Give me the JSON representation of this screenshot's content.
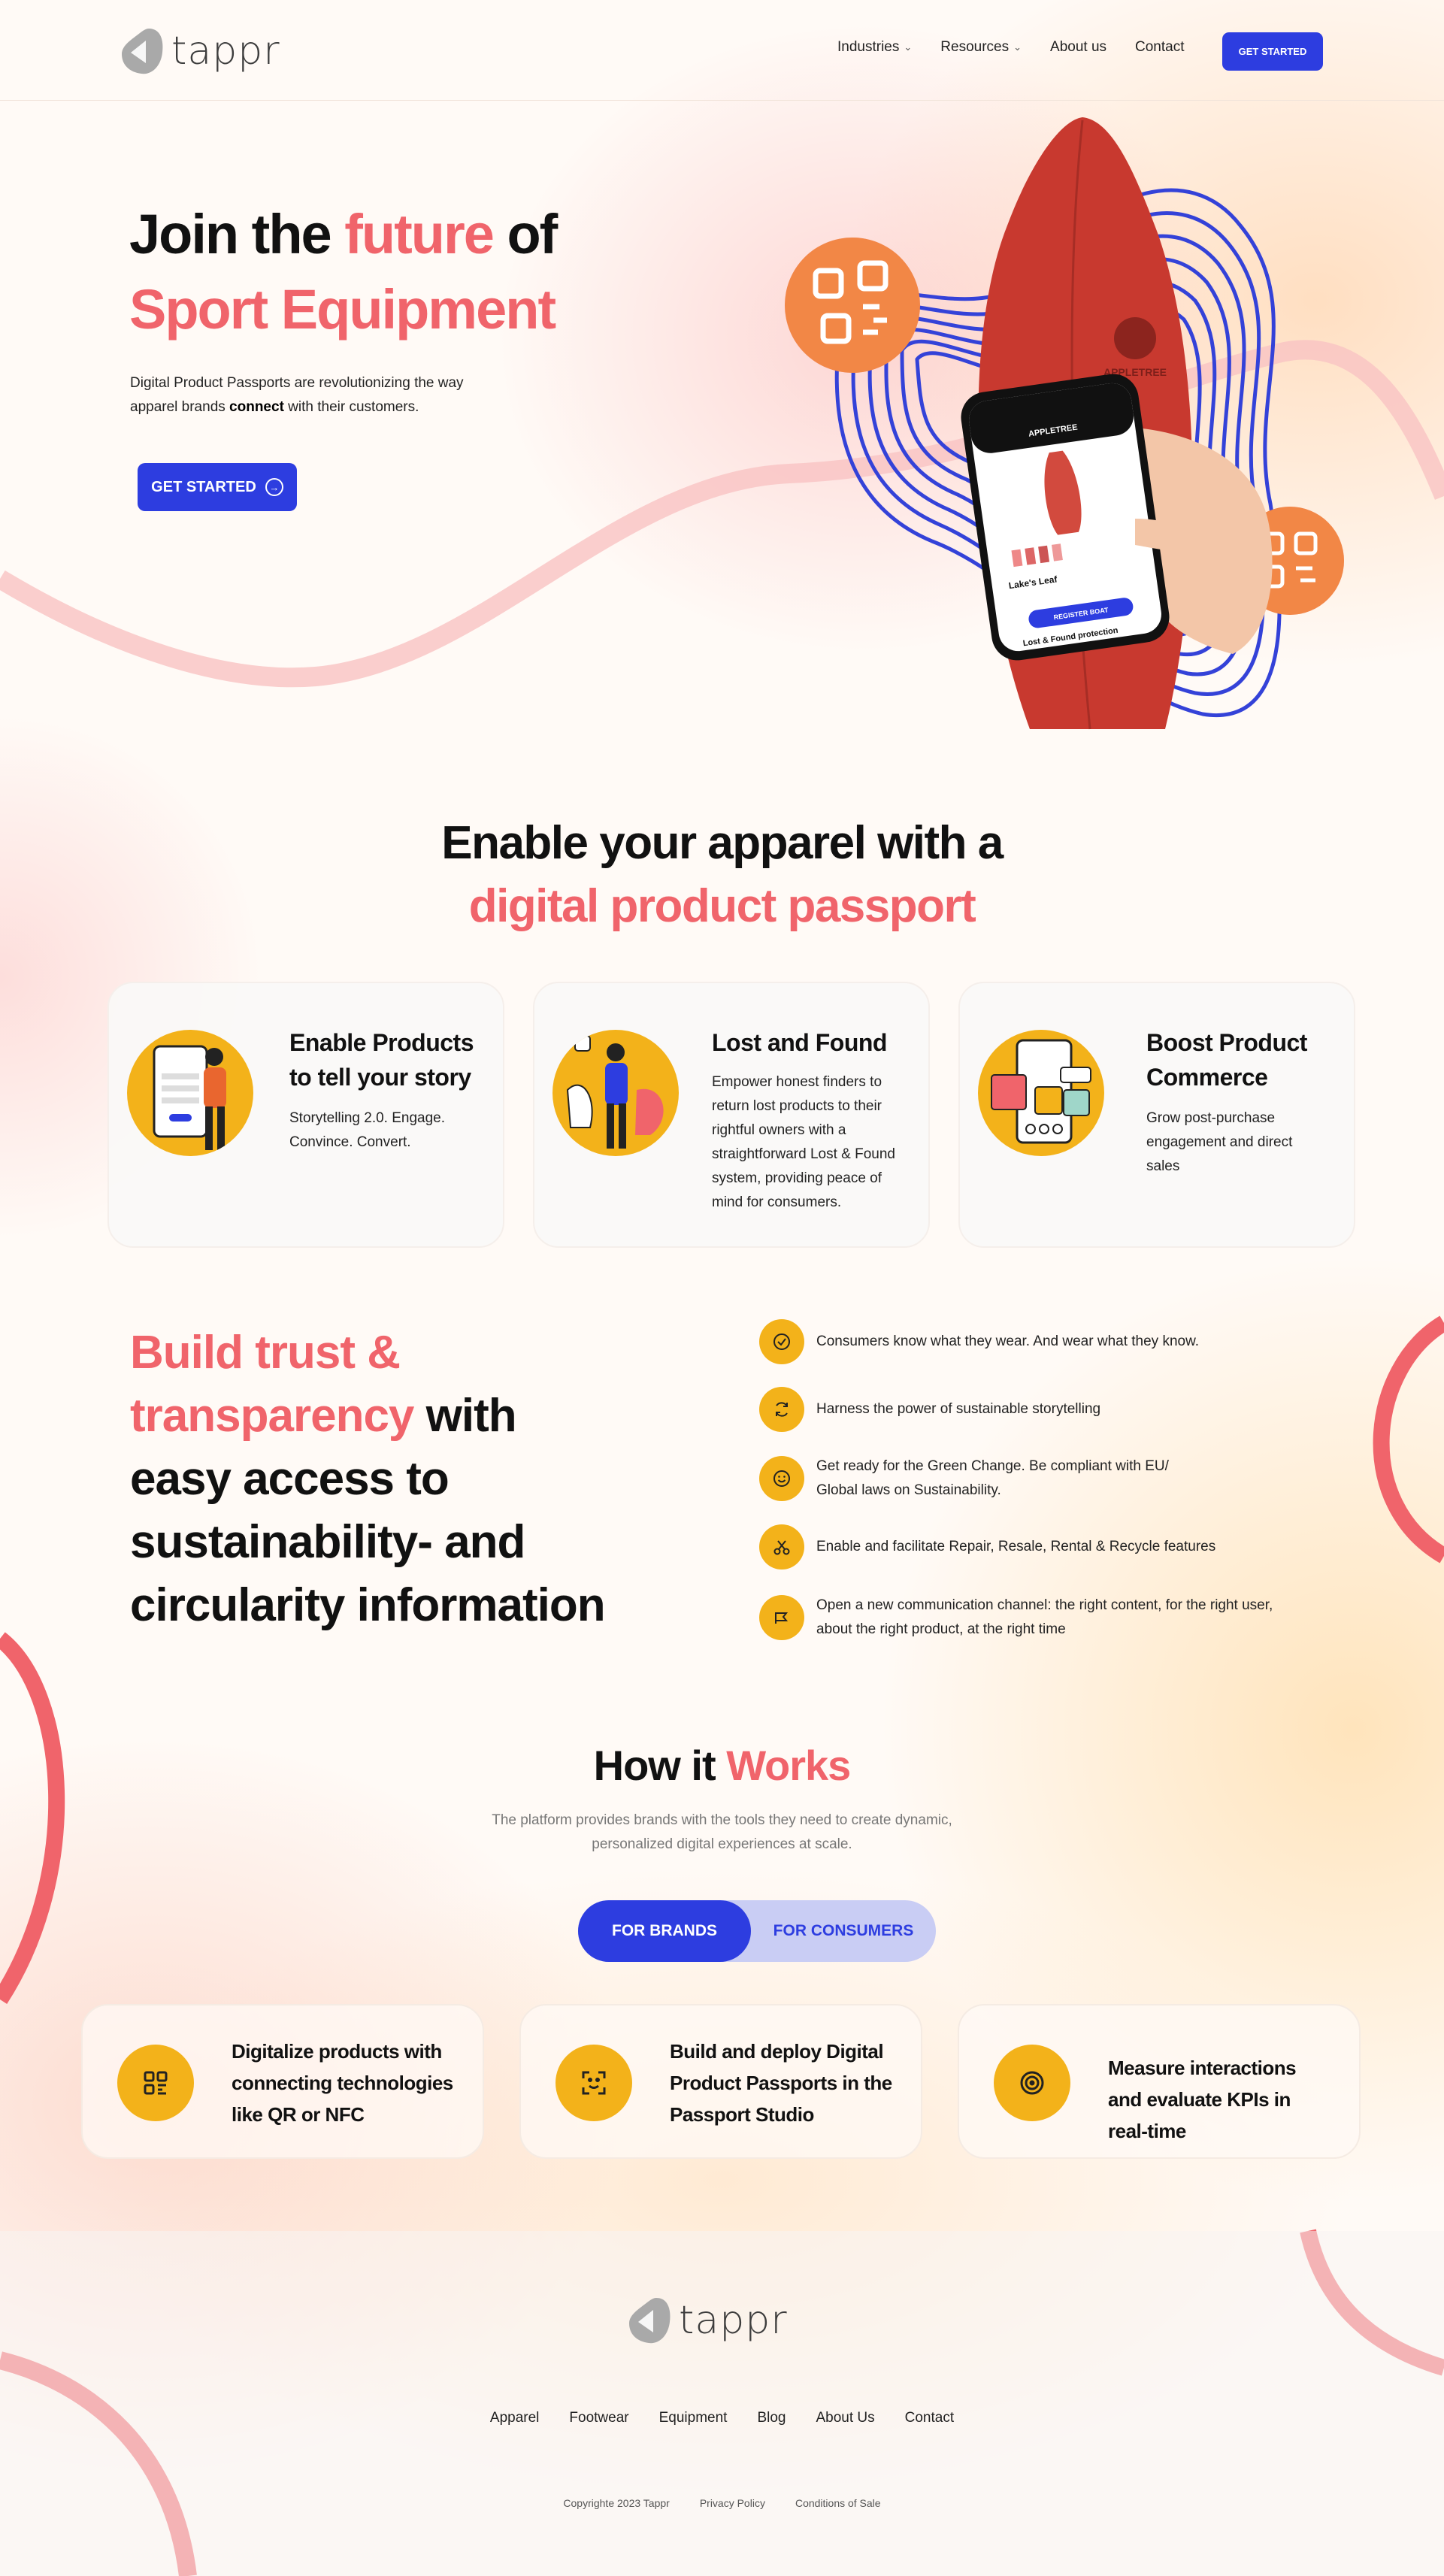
{
  "nav": {
    "logo_text": "tappr",
    "items": [
      {
        "label": "Industries",
        "dropdown": true
      },
      {
        "label": "Resources",
        "dropdown": true
      },
      {
        "label": "About us",
        "dropdown": false
      },
      {
        "label": "Contact",
        "dropdown": false
      }
    ],
    "cta": "GET STARTED"
  },
  "hero": {
    "title_1": "Join the ",
    "title_accent_1": "future",
    "title_2": " of",
    "title_accent_2": "Sport Equipment",
    "subtitle_1": "Digital Product Passports are revolutionizing the way apparel brands ",
    "subtitle_bold": "connect",
    "subtitle_2": " with their customers.",
    "cta": "GET STARTED",
    "board_brand": "APPLETREE",
    "phone": {
      "brand": "APPLETREE",
      "product": "Lake's Leaf",
      "button": "REGISTER BOAT",
      "footer": "Lost & Found protection"
    }
  },
  "enable": {
    "title": "Enable your apparel with a",
    "title_accent": "digital product passport",
    "cards": [
      {
        "title": "Enable Products to tell your story",
        "body": "Storytelling 2.0. Engage. Convince. Convert."
      },
      {
        "title": "Lost and Found",
        "body": "Empower honest finders to return lost products to their rightful owners with a straightforward Lost & Found system, providing peace of mind for consumers."
      },
      {
        "title": "Boost Product Commerce",
        "body": "Grow post-purchase engagement and direct sales"
      }
    ]
  },
  "trust": {
    "title_accent": "Build trust & transparency",
    "title_rest": " with easy access to sustainability- and circularity information",
    "features": [
      {
        "icon": "check-circle-icon",
        "text": "Consumers know what they wear. And wear what they know."
      },
      {
        "icon": "refresh-icon",
        "text": "Harness the power of sustainable storytelling"
      },
      {
        "icon": "smile-icon",
        "text": "Get ready for the Green Change. Be compliant with EU/ Global laws on Sustainability."
      },
      {
        "icon": "scissors-icon",
        "text": "Enable and facilitate Repair, Resale, Rental & Recycle features"
      },
      {
        "icon": "megaphone-icon",
        "text": "Open a new communication channel: the right content, for the right user, about the right product, at the right time"
      }
    ]
  },
  "how": {
    "title": "How it ",
    "title_accent": "Works",
    "subtitle": "The platform provides brands with the tools they need to create dynamic, personalized digital experiences at scale.",
    "toggle": [
      "FOR BRANDS",
      "FOR CONSUMERS"
    ],
    "cards": [
      {
        "icon": "qr-code-icon",
        "text": "Digitalize products with connecting technologies like QR or NFC"
      },
      {
        "icon": "scan-icon",
        "text": "Build and deploy Digital Product Passports in the Passport Studio"
      },
      {
        "icon": "target-icon",
        "text": "Measure interactions and evaluate KPIs in real-time"
      }
    ]
  },
  "footer": {
    "logo_text": "tappr",
    "links": [
      "Apparel",
      "Footwear",
      "Equipment",
      "Blog",
      "About Us",
      "Contact"
    ],
    "copyright": "Copyrighte 2023 Tappr",
    "privacy": "Privacy Policy",
    "conditions": "Conditions of Sale"
  },
  "colors": {
    "accent": "#f0646b",
    "primary": "#2d3de0",
    "yellow": "#f3b21a"
  }
}
